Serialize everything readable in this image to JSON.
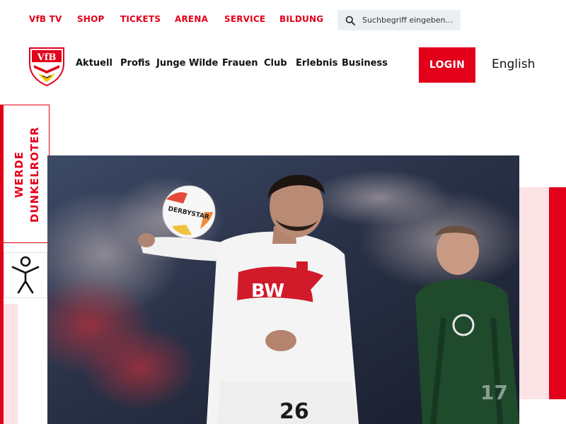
{
  "top_nav": {
    "items": [
      {
        "label": "VfB TV"
      },
      {
        "label": "SHOP"
      },
      {
        "label": "TICKETS"
      },
      {
        "label": "ARENA"
      },
      {
        "label": "SERVICE"
      },
      {
        "label": "BILDUNG"
      }
    ],
    "search_placeholder": "Suchbegriff eingeben..."
  },
  "main_nav": {
    "items": [
      {
        "label": "Aktuell"
      },
      {
        "label": "Profis"
      },
      {
        "label": "Junge Wilde"
      },
      {
        "label": "Frauen"
      },
      {
        "label": "Club"
      },
      {
        "label": "Erlebnis"
      },
      {
        "label": "Business"
      }
    ],
    "login_label": "LOGIN",
    "language_label": "English"
  },
  "side_widget": {
    "line1": "WERDE",
    "line2": "DUNKELROTER"
  },
  "hero": {
    "jersey_sponsor": "BW",
    "jersey_number": "26",
    "ball_text": "DERBYSTAR"
  },
  "colors": {
    "brand_red": "#e2001a",
    "light_pink": "#fbe3e6",
    "search_bg": "#eceff1"
  },
  "icons": [
    "search-icon",
    "vfb-logo",
    "accessibility-icon"
  ]
}
